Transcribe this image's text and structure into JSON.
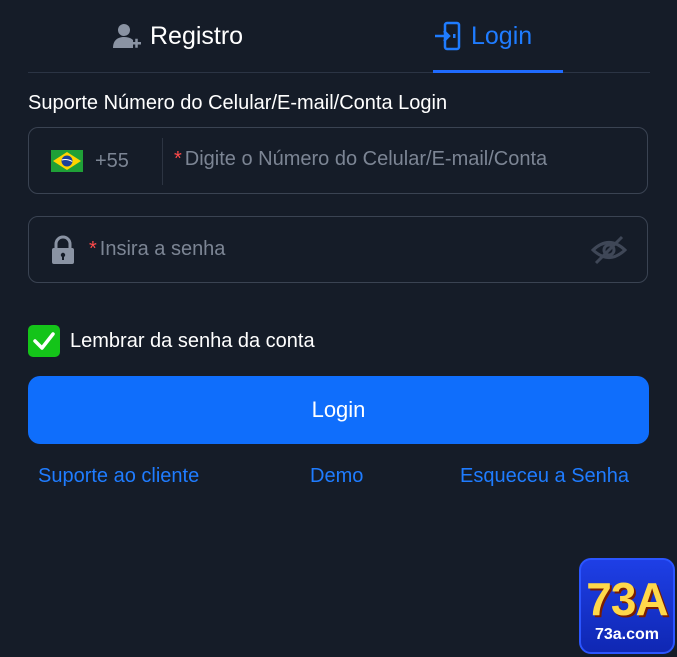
{
  "tabs": {
    "registro": {
      "label": "Registro",
      "icon": "user-add-icon"
    },
    "login": {
      "label": "Login",
      "icon": "login-door-icon",
      "active": true
    }
  },
  "subtitle": "Suporte Número do Celular/E-mail/Conta Login",
  "phone_field": {
    "country_code": "+55",
    "flag": "brazil-flag-icon",
    "required_mark": "*",
    "placeholder": "Digite o Número do Celular/E-mail/Conta"
  },
  "password_field": {
    "required_mark": "*",
    "placeholder": "Insira a senha",
    "icon": "lock-icon",
    "toggle_icon": "eye-slash-icon"
  },
  "remember": {
    "label": "Lembrar da senha da conta",
    "checked": true
  },
  "login_button": "Login",
  "links": {
    "support": "Suporte ao cliente",
    "demo": "Demo",
    "forgot": "Esqueceu a Senha"
  },
  "logo": {
    "main": "73A",
    "sub": "73a.com"
  },
  "colors": {
    "background": "#151c28",
    "accent": "#1f7cff",
    "button": "#0f6efc",
    "checkbox": "#14c419",
    "required": "#ff4a4a",
    "placeholder": "#7c8594"
  }
}
